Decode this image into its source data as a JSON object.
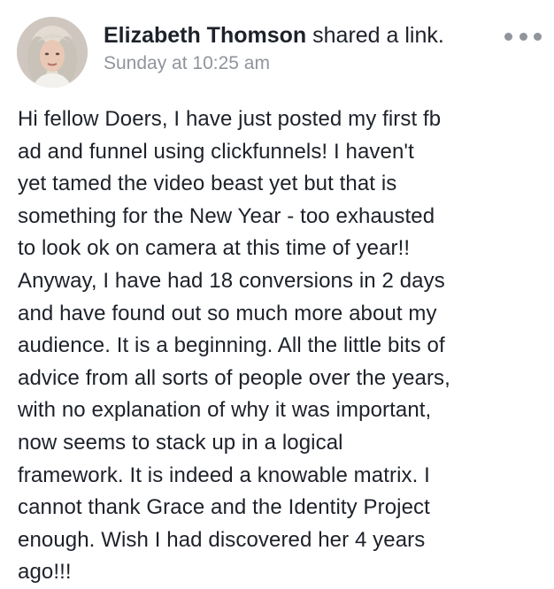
{
  "post": {
    "author": "Elizabeth Thomson",
    "action": " shared a link.",
    "timestamp": "Sunday at 10:25 am",
    "more_icon": "more-horizontal-icon",
    "body": "Hi fellow Doers,  I have just posted my first fb\nad and funnel using clickfunnels!  I haven't\nyet tamed the video beast yet but that is\nsomething for the New Year - too exhausted\nto look ok on camera at this time of year!!\nAnyway, I have had 18 conversions in 2 days\nand have found out so much more about my\naudience. It is a beginning. All the little bits of\nadvice from all sorts of people over the years,\nwith no explanation of why it was important,\nnow seems to stack up in a logical\nframework. It is indeed a knowable matrix.  I\ncannot thank Grace and the Identity Project\nenough.  Wish I had discovered her 4 years\nago!!!"
  },
  "colors": {
    "text": "#1d2129",
    "meta": "#90949c",
    "background": "#ffffff"
  }
}
